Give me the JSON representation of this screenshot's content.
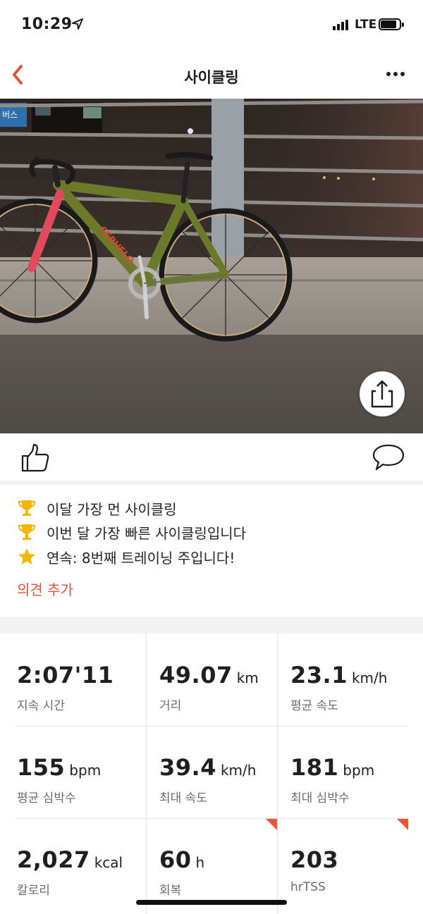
{
  "status_bar": {
    "time": "10:29",
    "network": "LTE"
  },
  "nav": {
    "title": "사이클링"
  },
  "achievements": [
    {
      "icon": "trophy-icon",
      "text": "이달 가장 먼 사이클링"
    },
    {
      "icon": "trophy-icon",
      "text": "이번 달 가장 빠른 사이클링입니다"
    },
    {
      "icon": "star-icon",
      "text": "연속: 8번째 트레이닝 주입니다!"
    }
  ],
  "add_comment_label": "의견 추가",
  "photo": {
    "sign_text": "버스",
    "bike_brand": "CERVELO"
  },
  "stats": [
    {
      "value": "2:07'11",
      "unit": "",
      "label": "지속 시간"
    },
    {
      "value": "49.07",
      "unit": "km",
      "label": "거리"
    },
    {
      "value": "23.1",
      "unit": "km/h",
      "label": "평균 속도"
    },
    {
      "value": "155",
      "unit": "bpm",
      "label": "평균 심박수"
    },
    {
      "value": "39.4",
      "unit": "km/h",
      "label": "최대 속도"
    },
    {
      "value": "181",
      "unit": "bpm",
      "label": "최대 심박수"
    },
    {
      "value": "2,027",
      "unit": "kcal",
      "label": "칼로리"
    },
    {
      "value": "60",
      "unit": "h",
      "label": "회복"
    },
    {
      "value": "203",
      "unit": "",
      "label": "hrTSS"
    }
  ],
  "colors": {
    "accent": "#e0543a",
    "trophy": "#f2b705",
    "text": "#1f1f1f",
    "muted": "#6b6b6b"
  }
}
